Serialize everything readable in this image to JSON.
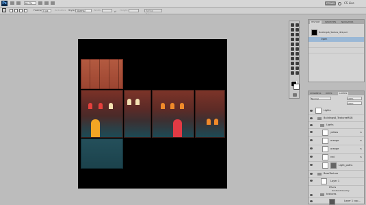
{
  "menubar": {
    "logo": "Ps",
    "items": [
      "",
      "",
      "",
      ""
    ],
    "workspace_button": "ETHAN",
    "cs_live": "CS Live"
  },
  "options_bar": {
    "feather_label": "Feather:",
    "feather_value": "0 px",
    "antialias_label": "Anti-alias",
    "style_label": "Style:",
    "style_value": "Normal",
    "width_label": "Width:",
    "height_label": "Height:",
    "refine_edge": "Refine Edge..."
  },
  "history_panel": {
    "tabs": [
      "HISTORY",
      "SWATCHES",
      "NAVIGATOR"
    ],
    "snapshot": "Buildings6_Texture_d01.psd",
    "items": [
      "Open",
      "",
      ""
    ]
  },
  "layers_panel": {
    "tabs": [
      "CHANNELS",
      "PATHS",
      "LAYERS"
    ],
    "blend_mode": "Normal",
    "opacity": "100%",
    "fill": "100%",
    "layers": [
      {
        "name": "Lights",
        "kind": "layer"
      },
      {
        "name": "Buildings6_TextureeRGB",
        "kind": "group"
      },
      {
        "name": "Lights",
        "kind": "group"
      },
      {
        "name": "yellow",
        "kind": "layer"
      },
      {
        "name": "orange",
        "kind": "layer"
      },
      {
        "name": "orange",
        "kind": "layer"
      },
      {
        "name": "red",
        "kind": "layer"
      },
      {
        "name": "Light_paths",
        "kind": "layer"
      },
      {
        "name": "BaseTexture",
        "kind": "group"
      },
      {
        "name": "Layer 1",
        "kind": "layer"
      },
      {
        "name": "Effects",
        "kind": "effect"
      },
      {
        "name": "Gradient Overlay",
        "kind": "effect"
      },
      {
        "name": "textures",
        "kind": "group"
      },
      {
        "name": "Layer 1 cop...",
        "kind": "layer"
      }
    ]
  },
  "colors": {
    "menu_bg": "#d6d6d6",
    "workspace_bg": "#bcbcbc",
    "canvas_bg": "#000000",
    "roof_top": "#b5573e",
    "roof_side": "#8b3a2c",
    "teal_base": "#1d4a55",
    "window_red": "#e23a3a",
    "window_yellow": "#f2a626",
    "window_white": "#f6e5b5",
    "window_orange": "#f0892a",
    "selected_row": "#9ab8d6"
  }
}
